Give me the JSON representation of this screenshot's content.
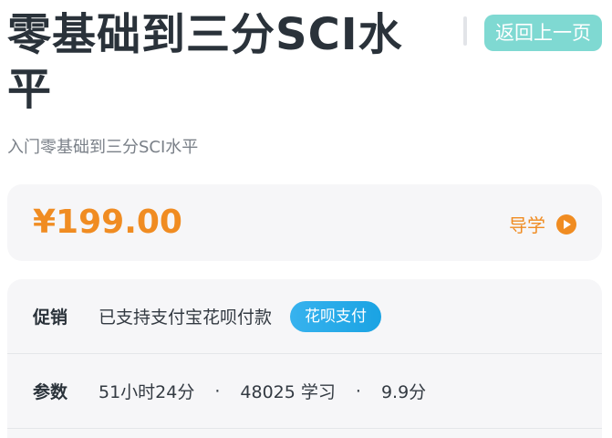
{
  "header": {
    "title": "零基础到三分SCI水平",
    "back_label": "返回上一页",
    "subtitle": "入门零基础到三分SCI水平"
  },
  "price": {
    "value": "¥199.00",
    "guide_label": "导学"
  },
  "info": {
    "promo_label": "促销",
    "promo_text": "已支持支付宝花呗付款",
    "promo_badge": "花呗支付",
    "params_label": "参数",
    "duration": "51小时24分",
    "separator": "·",
    "learners": "48025 学习",
    "rating": "9.9分"
  },
  "colors": {
    "accent_orange": "#f08c22",
    "back_button": "#7fd9d2",
    "badge_blue": "#1aa3e3"
  },
  "icons": {
    "guide": "play-circle-icon"
  }
}
